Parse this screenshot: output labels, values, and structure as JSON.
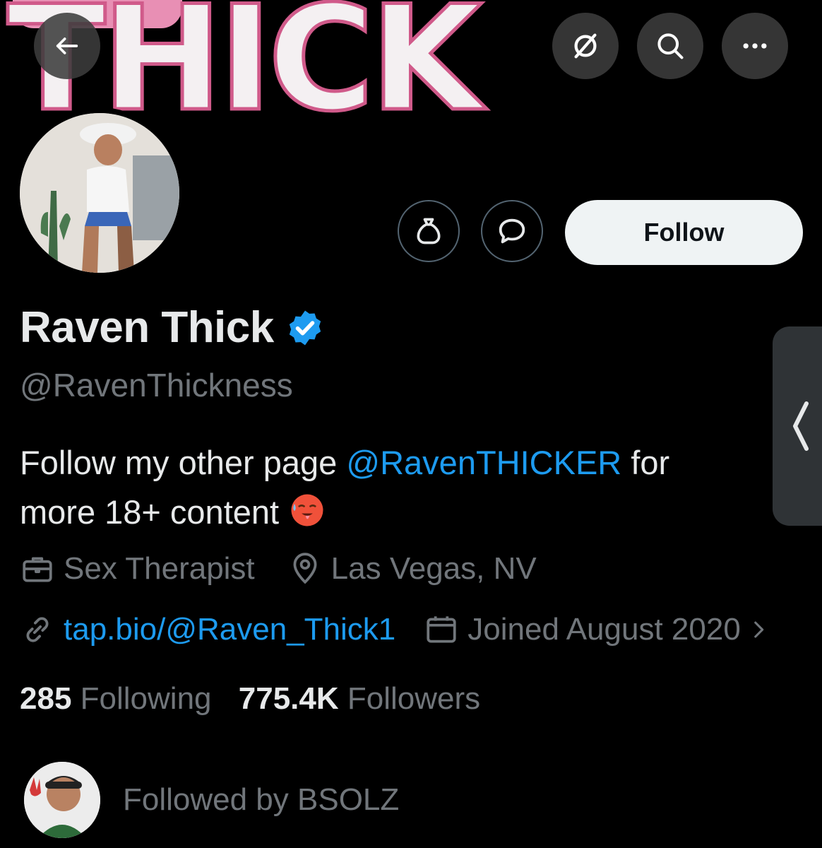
{
  "banner": {
    "word": "THICK"
  },
  "header": {
    "back_icon": "arrow-left-icon",
    "grok_icon": "grok-slash-circle-icon",
    "search_icon": "search-icon",
    "more_icon": "more-horizontal-icon"
  },
  "actions": {
    "tip_icon": "money-bag-icon",
    "message_icon": "chat-bubble-icon",
    "follow_label": "Follow"
  },
  "profile": {
    "name": "Raven Thick",
    "verified": true,
    "handle": "@RavenThickness",
    "bio_prefix": "Follow my other page ",
    "bio_mention": "@RavenTHICKER",
    "bio_suffix": " for more 18+ content",
    "bio_emoji": "hot-face-emoji",
    "profession": "Sex Therapist",
    "location": "Las Vegas, NV",
    "link": "tap.bio/@Raven_Thick1",
    "joined": "Joined August 2020"
  },
  "counts": {
    "following_value": "285",
    "following_label": " Following",
    "followers_value": "775.4K",
    "followers_label": " Followers"
  },
  "followed_by": {
    "text": "Followed by BSOLZ"
  },
  "colors": {
    "background": "#000000",
    "text": "#e7e9ea",
    "secondary": "#71767b",
    "accent": "#1d9bf0",
    "banner_outline": "#d05a8a"
  }
}
